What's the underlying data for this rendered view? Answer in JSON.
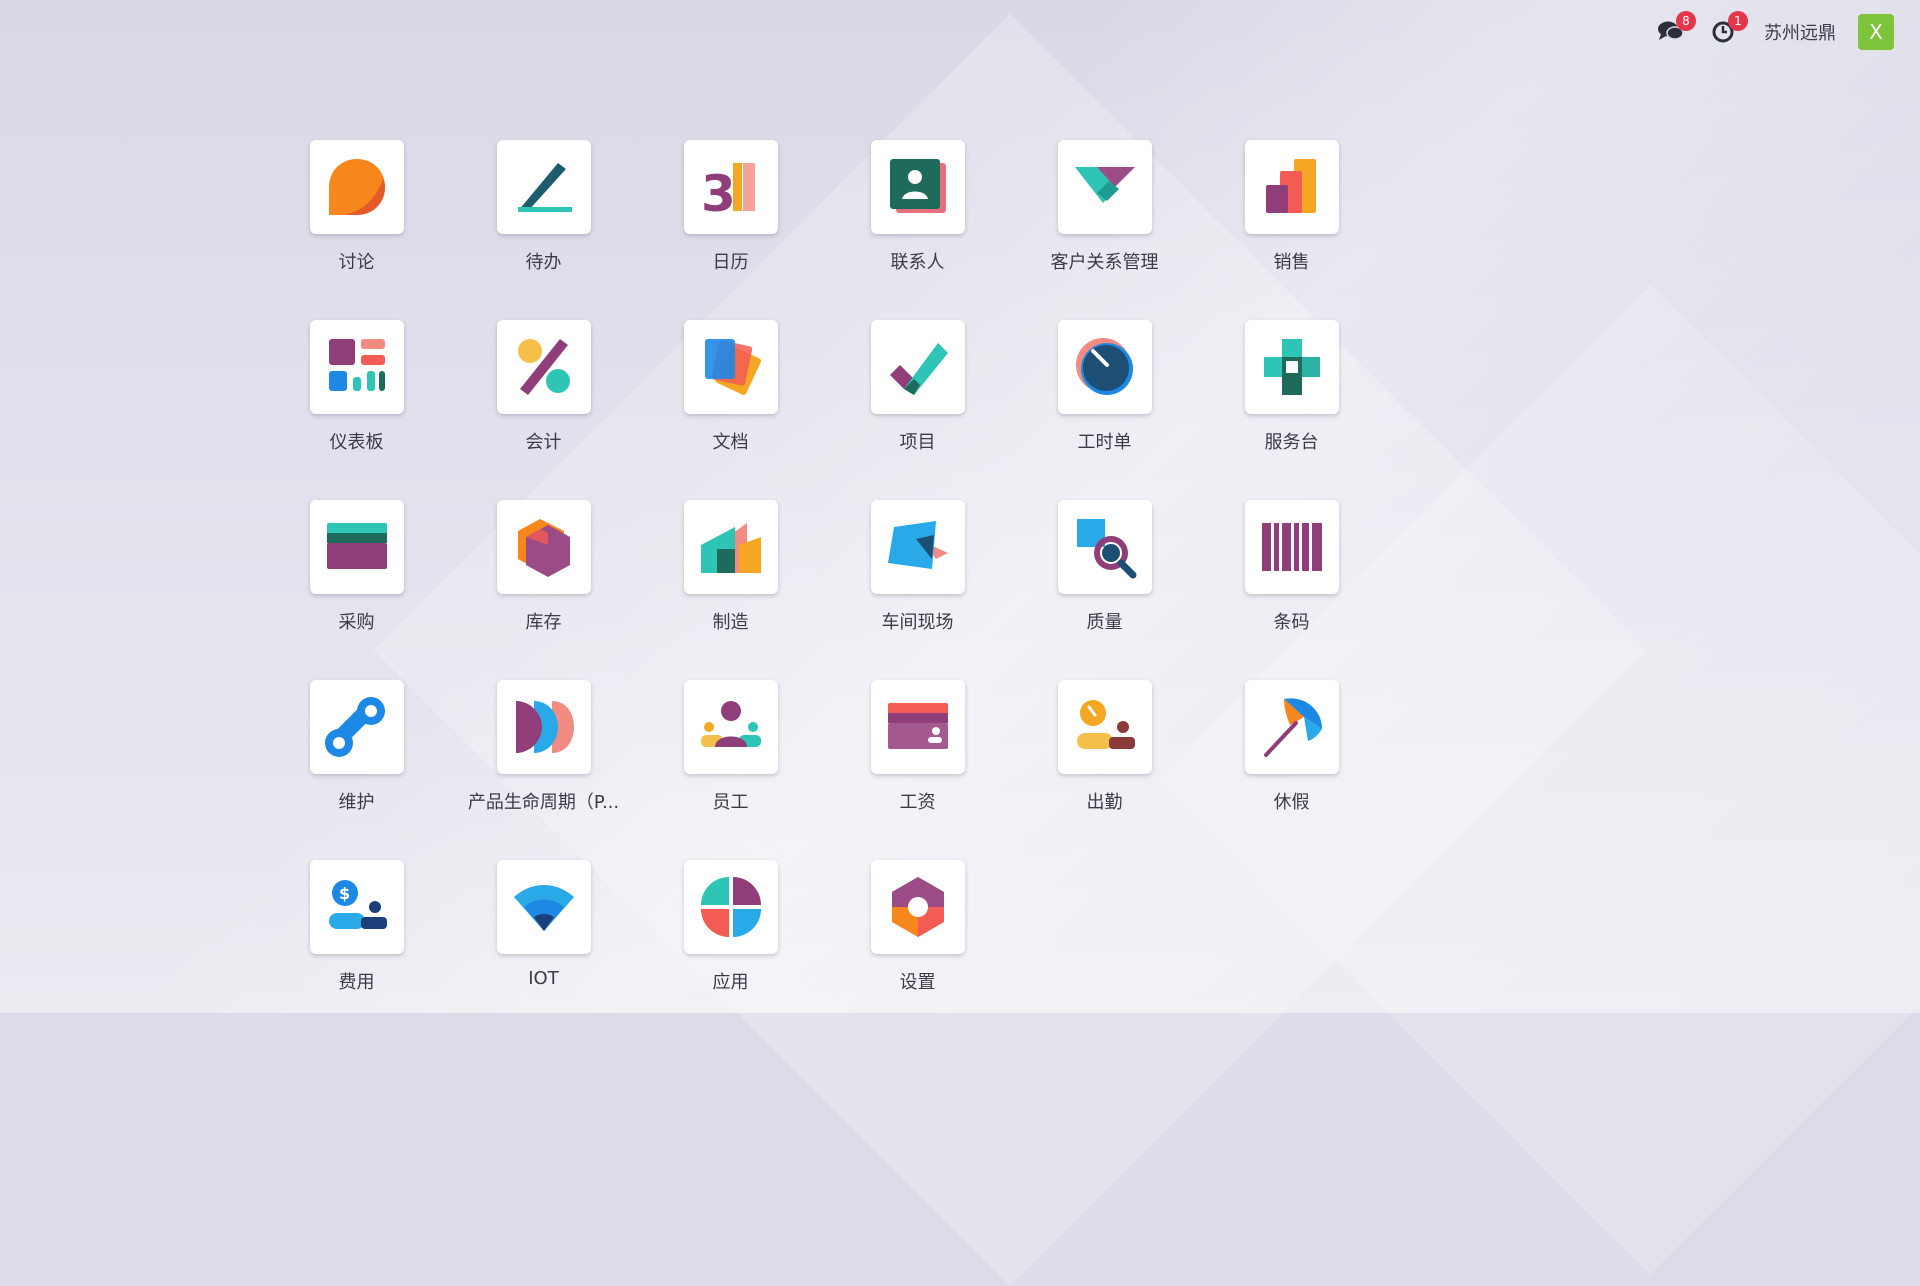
{
  "topbar": {
    "messages_badge": "8",
    "activity_badge": "1",
    "company": "苏州远鼎",
    "avatar_letter": "X",
    "avatar_color": "#7dc43b"
  },
  "apps": [
    {
      "label": "讨论",
      "icon": "discuss-icon"
    },
    {
      "label": "待办",
      "icon": "todo-icon"
    },
    {
      "label": "日历",
      "icon": "calendar-icon"
    },
    {
      "label": "联系人",
      "icon": "contacts-icon"
    },
    {
      "label": "客户关系管理",
      "icon": "crm-icon"
    },
    {
      "label": "销售",
      "icon": "sales-icon"
    },
    {
      "label": "仪表板",
      "icon": "dashboard-icon"
    },
    {
      "label": "会计",
      "icon": "accounting-icon"
    },
    {
      "label": "文档",
      "icon": "documents-icon"
    },
    {
      "label": "项目",
      "icon": "project-icon"
    },
    {
      "label": "工时单",
      "icon": "timesheet-icon"
    },
    {
      "label": "服务台",
      "icon": "helpdesk-icon"
    },
    {
      "label": "采购",
      "icon": "purchase-icon"
    },
    {
      "label": "库存",
      "icon": "inventory-icon"
    },
    {
      "label": "制造",
      "icon": "manufacturing-icon"
    },
    {
      "label": "车间现场",
      "icon": "shopfloor-icon"
    },
    {
      "label": "质量",
      "icon": "quality-icon"
    },
    {
      "label": "条码",
      "icon": "barcode-icon"
    },
    {
      "label": "维护",
      "icon": "maintenance-icon"
    },
    {
      "label": "产品生命周期（P...",
      "icon": "plm-icon"
    },
    {
      "label": "员工",
      "icon": "employees-icon"
    },
    {
      "label": "工资",
      "icon": "payroll-icon"
    },
    {
      "label": "出勤",
      "icon": "attendance-icon"
    },
    {
      "label": "休假",
      "icon": "timeoff-icon"
    },
    {
      "label": "费用",
      "icon": "expenses-icon"
    },
    {
      "label": "IOT",
      "icon": "iot-icon"
    },
    {
      "label": "应用",
      "icon": "apps-icon"
    },
    {
      "label": "设置",
      "icon": "settings-icon"
    }
  ]
}
